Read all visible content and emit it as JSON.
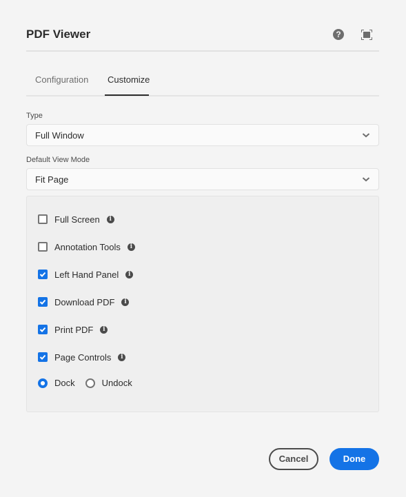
{
  "dialog": {
    "title": "PDF Viewer",
    "header_icons": [
      "help-icon",
      "fullscreen-icon"
    ],
    "help_glyph": "?"
  },
  "tabs": [
    {
      "label": "Configuration",
      "active": false
    },
    {
      "label": "Customize",
      "active": true
    }
  ],
  "fields": {
    "type": {
      "label": "Type",
      "value": "Full Window"
    },
    "view_mode": {
      "label": "Default View Mode",
      "value": "Fit Page"
    }
  },
  "options": [
    {
      "label": "Full Screen",
      "checked": false
    },
    {
      "label": "Annotation Tools",
      "checked": false
    },
    {
      "label": "Left Hand Panel",
      "checked": true
    },
    {
      "label": "Download PDF",
      "checked": true
    },
    {
      "label": "Print PDF",
      "checked": true
    },
    {
      "label": "Page Controls",
      "checked": true
    }
  ],
  "info_glyph": "i",
  "dock": {
    "options": [
      {
        "label": "Dock",
        "selected": true
      },
      {
        "label": "Undock",
        "selected": false
      }
    ]
  },
  "buttons": {
    "cancel": "Cancel",
    "done": "Done"
  },
  "colors": {
    "accent": "#1473e6",
    "background": "#f4f4f4",
    "panel": "#efefef"
  }
}
